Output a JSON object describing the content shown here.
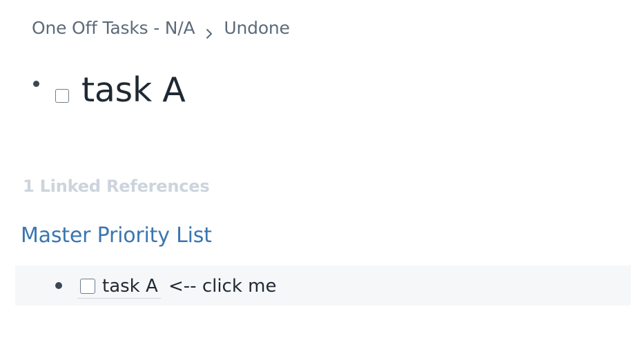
{
  "breadcrumb": {
    "items": [
      "One Off Tasks - N/A",
      "Undone"
    ],
    "separator_icon": "chevron-right-icon"
  },
  "page": {
    "title": "task A",
    "checked": false
  },
  "references": {
    "header": "1 Linked References",
    "groups": [
      {
        "page_title": "Master Priority List",
        "block": {
          "embed_text": "task A",
          "trailing_text": " <-- click me",
          "checked": false
        }
      }
    ]
  },
  "colors": {
    "link": "#3a76b0",
    "muted_header": "#ccd4dd",
    "breadcrumb": "#5c6b7a",
    "text": "#1f2933",
    "block_bg": "#f6f7f9"
  }
}
